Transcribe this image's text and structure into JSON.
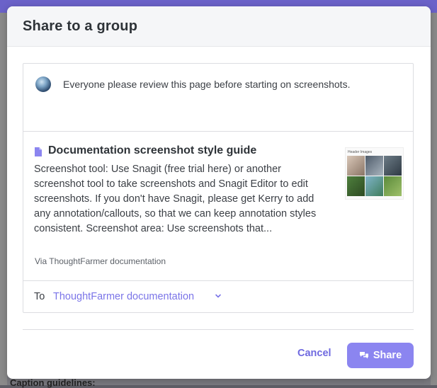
{
  "modal": {
    "title": "Share to a group",
    "message": "Everyone please review this page before starting on screenshots.",
    "preview": {
      "title": "Documentation screenshot style guide",
      "body": "Screenshot tool: Use Snagit (free trial here) or another screenshot tool to take screenshots and Snagit Editor to edit screenshots. If you don't have Snagit, please get Kerry to add any annotation/callouts, so that we can keep annotation styles consistent. Screenshot area: Use screenshots that...",
      "via": "Via ThoughtFarmer documentation",
      "thumbnail_title": "Header Images"
    },
    "to": {
      "label": "To",
      "group": "ThoughtFarmer documentation"
    },
    "buttons": {
      "cancel": "Cancel",
      "share": "Share"
    }
  },
  "background": {
    "bottom_text": "Caption guidelines:"
  },
  "colors": {
    "accent": "#8b85f0",
    "link": "#7b75e8",
    "topbar": "#6b62c9"
  },
  "icons": {
    "doc": "document-icon",
    "chevron": "chevron-down-icon",
    "share": "chat-bubbles-icon",
    "avatar": "avatar"
  }
}
